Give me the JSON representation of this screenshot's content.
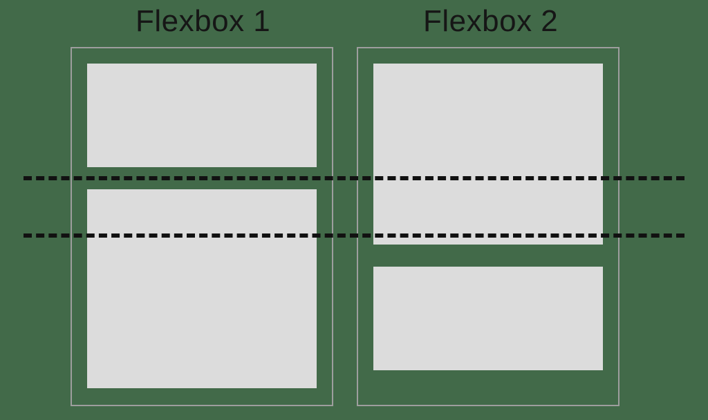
{
  "diagram": {
    "title1": "Flexbox 1",
    "title2": "Flexbox 2"
  }
}
